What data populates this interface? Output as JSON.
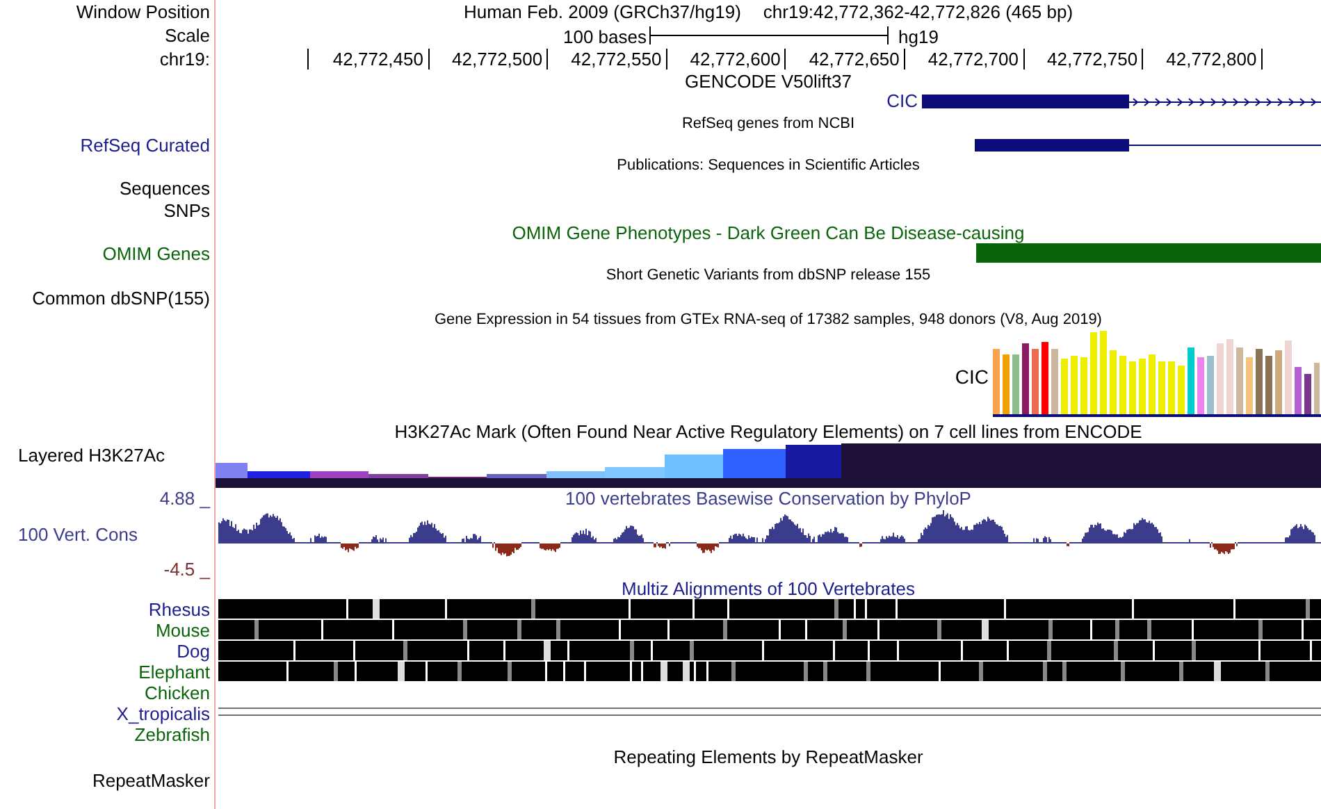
{
  "header": {
    "label": "Window Position",
    "title": "Human Feb. 2009 (GRCh37/hg19)",
    "position": "chr19:42,772,362-42,772,826 (465 bp)"
  },
  "scale": {
    "label": "Scale",
    "length": "100 bases",
    "assembly": "hg19"
  },
  "ruler": {
    "label": "chr19:",
    "ticks": [
      "42,772,450",
      "42,772,500",
      "42,772,550",
      "42,772,600",
      "42,772,650",
      "42,772,700",
      "42,772,750",
      "42,772,800"
    ]
  },
  "tracks": [
    {
      "kind": "gencode",
      "title": "GENCODE V50lift37",
      "gene": "CIC",
      "color": "#1c1c8c"
    },
    {
      "kind": "refseq",
      "title": "RefSeq genes from NCBI",
      "label": "RefSeq Curated",
      "color": "#1c1c8c"
    },
    {
      "kind": "label",
      "title": "Publications: Sequences in Scientific Articles",
      "label": "Sequences"
    },
    {
      "kind": "label",
      "label": "SNPs"
    },
    {
      "kind": "omim",
      "title": "OMIM Gene Phenotypes - Dark Green Can Be Disease-causing",
      "label": "OMIM Genes",
      "color": "#0a640a"
    },
    {
      "kind": "label",
      "title": "Short Genetic Variants from dbSNP release 155",
      "label": "Common dbSNP(155)"
    },
    {
      "kind": "gtex",
      "title": "Gene Expression in 54 tissues from GTEx RNA-seq of 17382 samples, 948 donors (V8, Aug 2019)",
      "gene": "CIC"
    },
    {
      "kind": "signal",
      "title": "H3K27Ac Mark (Often Found Near Active Regulatory Elements) on 7 cell lines from ENCODE",
      "label": "Layered H3K27Ac"
    },
    {
      "kind": "conservation",
      "title": "100 vertebrates Basewise Conservation by PhyloP",
      "label": "100 Vert. Cons",
      "max": "4.88 _",
      "min": "-4.5 _",
      "color": "#3c3c8c"
    },
    {
      "kind": "multiz",
      "title": "Multiz Alignments of 100 Vertebrates",
      "color": "#1c1c8c",
      "species": [
        {
          "name": "Rhesus",
          "kind": "blocks",
          "color": "#1c1c8c"
        },
        {
          "name": "Mouse",
          "kind": "blocks",
          "color": "#0a640a"
        },
        {
          "name": "Dog",
          "kind": "blocks",
          "color": "#1c1c8c"
        },
        {
          "name": "Elephant",
          "kind": "blocks",
          "color": "#0a640a"
        },
        {
          "name": "Chicken",
          "kind": "none",
          "color": "#0a640a"
        },
        {
          "name": "X_tropicalis",
          "kind": "lines",
          "color": "#1c1c8c"
        },
        {
          "name": "Zebrafish",
          "kind": "none",
          "color": "#0a640a"
        }
      ]
    },
    {
      "kind": "repeat",
      "title": "Repeating Elements by RepeatMasker",
      "label": "RepeatMasker"
    }
  ]
}
